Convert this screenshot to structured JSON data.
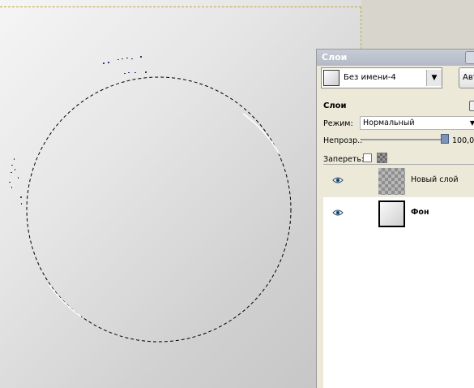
{
  "dock": {
    "title": "Слои",
    "image_name": "Без имени-4",
    "auto_label": "Авт"
  },
  "layers_panel": {
    "title": "Слои",
    "mode_label": "Режим:",
    "mode_value": "Нормальный",
    "opacity_label": "Непрозр.:",
    "opacity_value": "100,0",
    "lock_label": "Запереть:",
    "layers": [
      {
        "name": "Новый слой",
        "visible": true,
        "bold": false,
        "thumbnail": "transparent-checker"
      },
      {
        "name": "Фон",
        "visible": true,
        "bold": true,
        "thumbnail": "gradient-white"
      }
    ]
  },
  "icons": {
    "visibility": "eye-icon",
    "dropdown": "chevron-down-icon",
    "panel_menu": "panel-menu-icon"
  },
  "colors": {
    "dock_bg": "#ece9d8",
    "titlebar": "#b9bfca",
    "selection_stroke": "#000000",
    "canvas_border": "#b8a640",
    "slider_thumb": "#7b93b7"
  }
}
